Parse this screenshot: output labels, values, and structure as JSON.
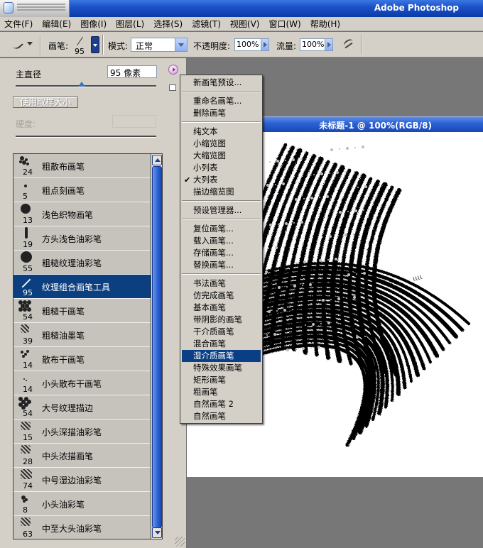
{
  "app": {
    "title": "Adobe Photoshop"
  },
  "menu": [
    "文件(F)",
    "编辑(E)",
    "图像(I)",
    "图层(L)",
    "选择(S)",
    "滤镜(T)",
    "视图(V)",
    "窗口(W)",
    "帮助(H)"
  ],
  "toolbar": {
    "brush_label": "画笔:",
    "brush_size": "95",
    "mode_label": "模式:",
    "mode_value": "正常",
    "opacity_label": "不透明度:",
    "opacity_value": "100%",
    "flow_label": "流量:",
    "flow_value": "100%"
  },
  "document": {
    "title": "未标题-1 @ 100%(RGB/8)"
  },
  "panel": {
    "master_label": "主直径",
    "master_value": "95 像素",
    "master_level": 0.47,
    "use_sample_label": "使用取样大小",
    "hardness_label": "硬度:",
    "brushes": [
      {
        "size": "24",
        "label": "粗散布画笔",
        "icon": "scatter-brush-icon"
      },
      {
        "size": "5",
        "label": "粗点刻画笔",
        "icon": "dot-brush-icon"
      },
      {
        "size": "13",
        "label": "浅色织物画笔",
        "icon": "round-brush-icon"
      },
      {
        "size": "19",
        "label": "方头浅色油彩笔",
        "icon": "flat-brush-icon"
      },
      {
        "size": "55",
        "label": "粗糙纹理油彩笔",
        "icon": "large-round-brush-icon"
      },
      {
        "size": "95",
        "label": "纹理组合画笔工具",
        "icon": "texture-combo-brush-icon",
        "selected": true
      },
      {
        "size": "54",
        "label": "粗糙干画笔",
        "icon": "dry-brush-icon"
      },
      {
        "size": "39",
        "label": "粗糙油墨笔",
        "icon": "ink-brush-icon"
      },
      {
        "size": "14",
        "label": "散布干画笔",
        "icon": "scatter-dry-brush-icon"
      },
      {
        "size": "14",
        "label": "小头散布干画笔",
        "icon": "small-scatter-brush-icon"
      },
      {
        "size": "54",
        "label": "大号纹理描边",
        "icon": "texture-stroke-icon"
      },
      {
        "size": "15",
        "label": "小头深描油彩笔",
        "icon": "small-oil-brush-icon"
      },
      {
        "size": "28",
        "label": "中头浓描画笔",
        "icon": "medium-brush-icon"
      },
      {
        "size": "74",
        "label": "中号湿边油彩笔",
        "icon": "wet-edge-brush-icon"
      },
      {
        "size": "8",
        "label": "小头油彩笔",
        "icon": "small-paint-brush-icon"
      },
      {
        "size": "63",
        "label": "中至大头油彩笔",
        "icon": "large-paint-brush-icon"
      }
    ]
  },
  "popup": {
    "groups": [
      [
        {
          "label": "新画笔预设..."
        }
      ],
      [
        {
          "label": "重命名画笔..."
        },
        {
          "label": "删除画笔"
        }
      ],
      [
        {
          "label": "纯文本"
        },
        {
          "label": "小缩览图"
        },
        {
          "label": "大缩览图"
        },
        {
          "label": "小列表"
        },
        {
          "label": "大列表",
          "checked": true
        },
        {
          "label": "描边缩览图"
        }
      ],
      [
        {
          "label": "预设管理器..."
        }
      ],
      [
        {
          "label": "复位画笔..."
        },
        {
          "label": "载入画笔..."
        },
        {
          "label": "存储画笔..."
        },
        {
          "label": "替换画笔..."
        }
      ],
      [
        {
          "label": "书法画笔"
        },
        {
          "label": "仿完成画笔"
        },
        {
          "label": "基本画笔"
        },
        {
          "label": "带阴影的画笔"
        },
        {
          "label": "干介质画笔"
        },
        {
          "label": "混合画笔"
        },
        {
          "label": "湿介质画笔",
          "highlighted": true
        },
        {
          "label": "特殊效果画笔"
        },
        {
          "label": "矩形画笔"
        },
        {
          "label": "粗画笔"
        },
        {
          "label": "自然画笔 2"
        },
        {
          "label": "自然画笔"
        }
      ]
    ],
    "check_glyph": "✔"
  }
}
